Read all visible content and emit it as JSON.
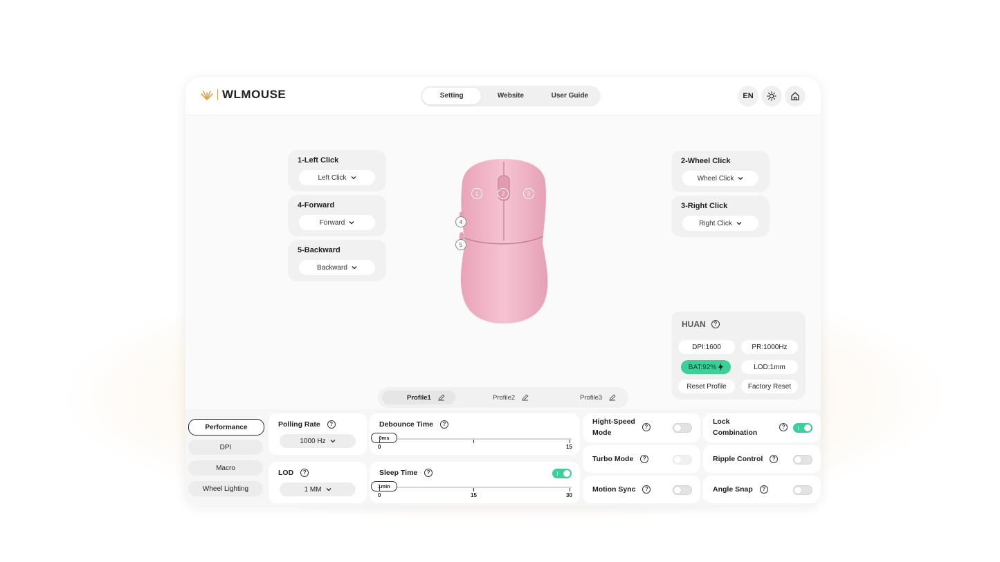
{
  "header": {
    "logo_text": "WLMOUSE",
    "tabs": [
      {
        "label": "Setting",
        "active": true
      },
      {
        "label": "Website",
        "active": false
      },
      {
        "label": "User Guide",
        "active": false
      }
    ],
    "lang_label": "EN",
    "icons": [
      "sun-icon",
      "home-icon"
    ]
  },
  "buttons": {
    "left": [
      {
        "title": "1-Left Click",
        "value": "Left Click"
      },
      {
        "title": "4-Forward",
        "value": "Forward"
      },
      {
        "title": "5-Backward",
        "value": "Backward"
      }
    ],
    "right": [
      {
        "title": "2-Wheel Click",
        "value": "Wheel Click"
      },
      {
        "title": "3-Right Click",
        "value": "Right Click"
      }
    ]
  },
  "mouse_markers": [
    "1",
    "2",
    "3",
    "4",
    "5"
  ],
  "device": {
    "name": "HUAN",
    "dpi": "DPI:1600",
    "polling": "PR:1000Hz",
    "battery": "BAT:92%",
    "lod": "LOD:1mm",
    "reset_profile": "Reset Profile",
    "factory_reset": "Factory Reset"
  },
  "profiles": [
    {
      "label": "Profile1",
      "active": true
    },
    {
      "label": "Profile2",
      "active": false
    },
    {
      "label": "Profile3",
      "active": false
    }
  ],
  "sidebar": [
    {
      "label": "Performance",
      "active": true
    },
    {
      "label": "DPI",
      "active": false
    },
    {
      "label": "Macro",
      "active": false
    },
    {
      "label": "Wheel Lighting",
      "active": false
    }
  ],
  "settings": {
    "polling_rate": {
      "title": "Polling Rate",
      "value": "1000 Hz"
    },
    "lod": {
      "title": "LOD",
      "value": "1 MM"
    },
    "debounce": {
      "title": "Debounce Time",
      "thumb": "0ms",
      "min": "0",
      "mid": "",
      "max": "15",
      "value": 0
    },
    "sleep": {
      "title": "Sleep Time",
      "thumb": "1min",
      "min": "0",
      "mid": "15",
      "max": "30",
      "value": 1,
      "enabled": true
    },
    "high_speed": {
      "title_line1": "Hight-Speed",
      "title_line2": "Mode",
      "enabled": false
    },
    "lock_combination": {
      "title_line1": "Lock",
      "title_line2": "Combination",
      "enabled": true
    },
    "turbo": {
      "title": "Turbo Mode",
      "enabled": false
    },
    "ripple": {
      "title": "Ripple Control",
      "enabled": false
    },
    "motion_sync": {
      "title": "Motion Sync",
      "enabled": false
    },
    "angle_snap": {
      "title": "Angle Snap",
      "enabled": false
    }
  },
  "colors": {
    "accent_green": "#3dcf9a",
    "mouse_pink": "#f2b6c8",
    "logo_orange": "#e3a04a"
  }
}
